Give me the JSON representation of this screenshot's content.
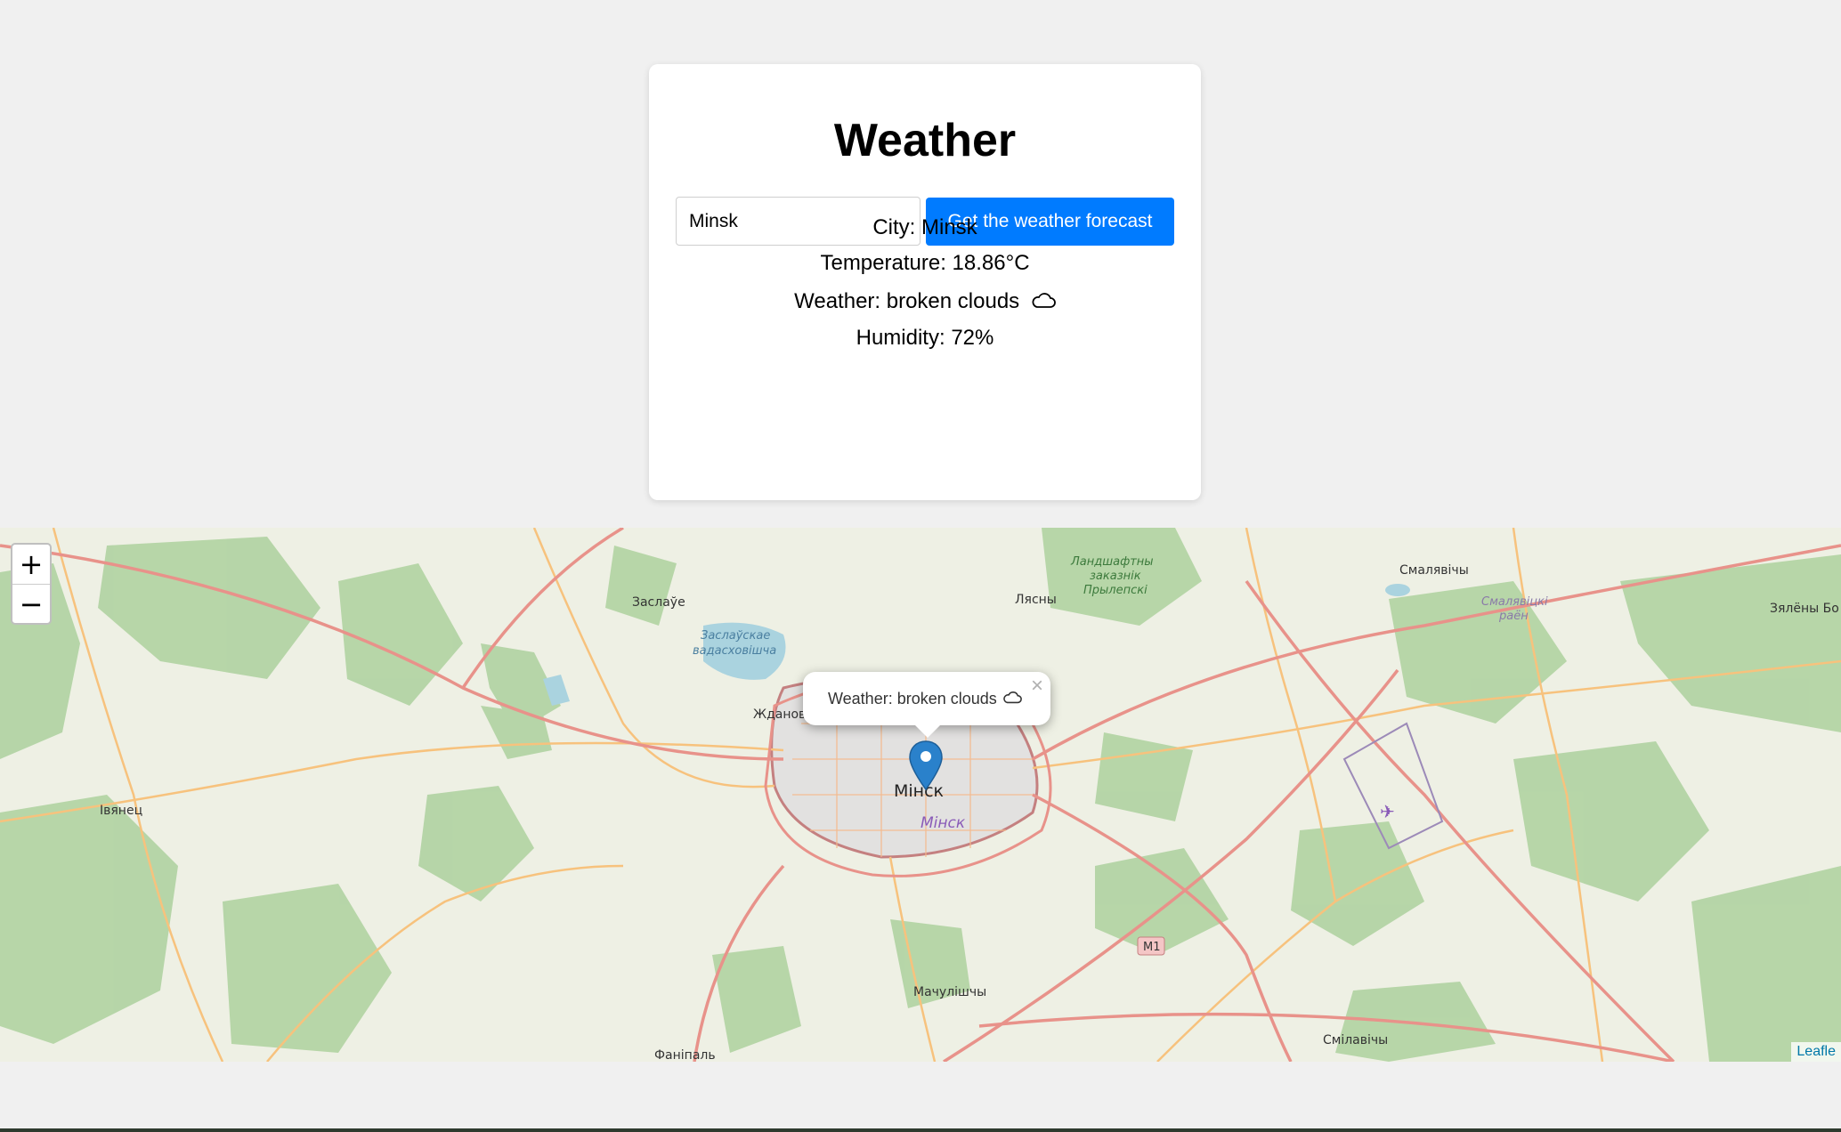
{
  "header": {
    "title": "Weather"
  },
  "search": {
    "value": "Minsk",
    "button_label": "Get the weather forecast"
  },
  "result": {
    "city": "City: Minsk",
    "temperature": "Temperature: 18.86°C",
    "weather": "Weather: broken clouds",
    "weather_icon": "cloud-icon",
    "humidity": "Humidity: 72%"
  },
  "map": {
    "zoom_in": "+",
    "zoom_out": "−",
    "popup": {
      "text": "Weather: broken clouds",
      "close": "×",
      "icon": "cloud-icon"
    },
    "attribution": "Leafle",
    "labels": {
      "zaslauje": "Заслаўе",
      "reservoir1": "Заслаўскае",
      "reservoir2": "вадасховішча",
      "lyasny": "Лясны",
      "landscape1": "Ландшафтны",
      "landscape2": "заказнік",
      "landscape3": "Прылепскі",
      "smalyavichy": "Смалявічы",
      "smalyavichy_raion1": "Смалявіцкі",
      "smalyavichy_raion2": "раён",
      "zyaleny_bor": "Зялёны Бо",
      "zhdanovichy": "Жданов",
      "ivyanets": "Івянец",
      "minsk": "Мінск",
      "minsk_italic": "Мінск",
      "m1": "M1",
      "machulishchy": "Мачулішчы",
      "smilavichy": "Смілавічы",
      "fanipal": "Фаніпаль"
    },
    "colors": {
      "land": "#eef0e4",
      "forest": "#add19e",
      "water": "#aad3df",
      "city": "#e0dfdf",
      "major_road": "#e8928a",
      "secondary_road": "#f7c27d",
      "marker": "#2a81cb",
      "accent_button": "#007bff"
    }
  }
}
